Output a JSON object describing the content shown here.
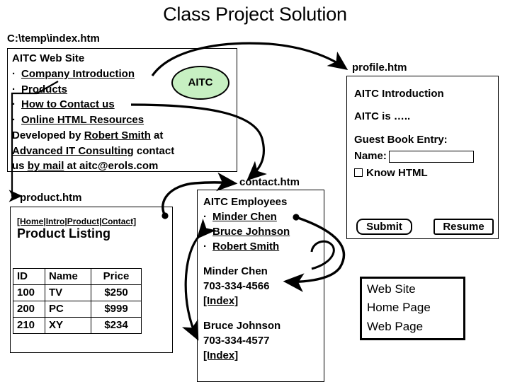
{
  "title": "Class Project Solution",
  "index_page": {
    "file_label": "C:\\temp\\index.htm",
    "heading": "AITC Web Site",
    "links": [
      "Company Introduction",
      "Products",
      "How to Contact us",
      "Online HTML Resources"
    ],
    "credit_line1_pre": "Developed by ",
    "credit_line1_link": "Robert Smith",
    "credit_line1_post": " at",
    "credit_line2_link": "Advanced IT Consulting",
    "credit_line2_post": " contact",
    "credit_line3_pre": "us ",
    "credit_line3_link": "by mail",
    "credit_line3_post": " at aitc@erols.com",
    "logo_label": "AITC"
  },
  "profile_page": {
    "file_label": "profile.htm",
    "heading": "AITC Introduction",
    "body": "AITC is …..",
    "guestbook_heading": "Guest Book Entry:",
    "name_label": "Name:",
    "name_value": "",
    "name_placeholder": "",
    "checkbox_label": "Know HTML",
    "checkbox_checked": false,
    "submit_label": "Submit",
    "resume_label": "Resume"
  },
  "product_page": {
    "file_label": "product.htm",
    "nav": [
      "[Home",
      "Intro",
      "Product",
      "Contact]"
    ],
    "nav_separator": "|",
    "heading": "Product Listing",
    "table": {
      "headers": [
        "ID",
        "Name",
        "Price"
      ],
      "rows": [
        [
          "100",
          "TV",
          "$250"
        ],
        [
          "200",
          "PC",
          "$999"
        ],
        [
          "210",
          "XY",
          "$234"
        ]
      ]
    }
  },
  "contact_page": {
    "file_label": "contact.htm",
    "heading": "AITC Employees",
    "links": [
      "Minder Chen",
      "Bruce Johnson",
      "Robert Smith"
    ],
    "entries": [
      {
        "name": "Minder Chen",
        "phone": "703-334-4566",
        "index_link": "[Index]"
      },
      {
        "name": "Bruce Johnson",
        "phone": "703-334-4577",
        "index_link": "[Index]"
      }
    ]
  },
  "legend": {
    "lines": [
      "Web Site",
      "Home Page",
      "Web Page"
    ]
  },
  "colors": {
    "logo_fill": "#c7f0c2",
    "stroke": "#000000",
    "background": "#ffffff"
  }
}
